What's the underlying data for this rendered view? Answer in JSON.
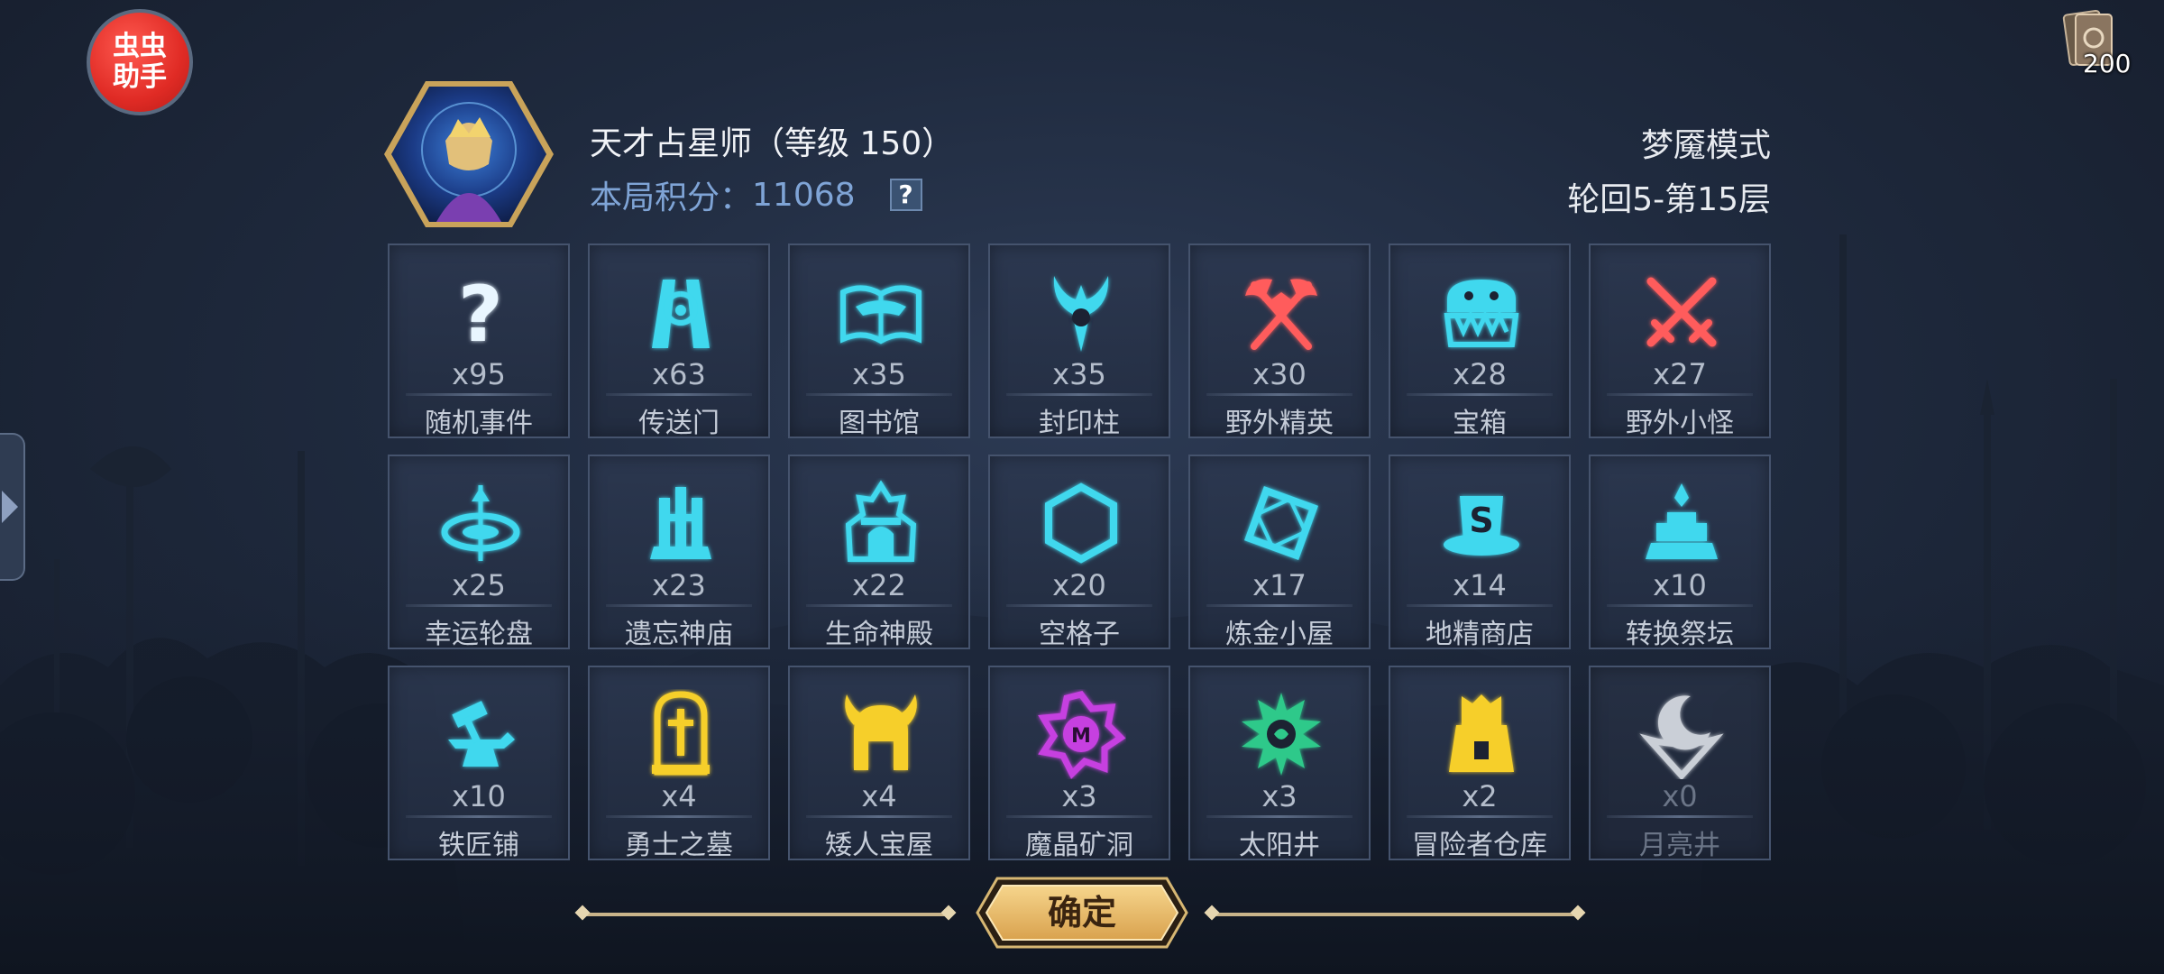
{
  "helper_badge": {
    "line1": "虫虫",
    "line2": "助手"
  },
  "card_counter": {
    "value": "200",
    "icon": "card-deck-icon"
  },
  "player": {
    "name": "天才占星师（等级 150）",
    "score_label": "本局积分：",
    "score_value": "11068",
    "help_label": "?"
  },
  "mode": {
    "name": "梦魇模式",
    "round": "轮回5-第15层"
  },
  "tiles": [
    {
      "label": "随机事件",
      "count": "x95",
      "icon": "question-mark-icon",
      "color": "#e9f6ff"
    },
    {
      "label": "传送门",
      "count": "x63",
      "icon": "portal-icon",
      "color": "#3fd8ee"
    },
    {
      "label": "图书馆",
      "count": "x35",
      "icon": "open-book-icon",
      "color": "#3fd8ee"
    },
    {
      "label": "封印柱",
      "count": "x35",
      "icon": "horned-seal-icon",
      "color": "#3fd8ee"
    },
    {
      "label": "野外精英",
      "count": "x30",
      "icon": "crossed-axes-icon",
      "color": "#ff5c5c"
    },
    {
      "label": "宝箱",
      "count": "x28",
      "icon": "mimic-chest-icon",
      "color": "#3fd8ee"
    },
    {
      "label": "野外小怪",
      "count": "x27",
      "icon": "crossed-swords-icon",
      "color": "#ff5c5c"
    },
    {
      "label": "幸运轮盘",
      "count": "x25",
      "icon": "lucky-wheel-icon",
      "color": "#3fd8ee"
    },
    {
      "label": "遗忘神庙",
      "count": "x23",
      "icon": "temple-icon",
      "color": "#3fd8ee"
    },
    {
      "label": "生命神殿",
      "count": "x22",
      "icon": "life-shrine-icon",
      "color": "#3fd8ee"
    },
    {
      "label": "空格子",
      "count": "x20",
      "icon": "hexagon-icon",
      "color": "#3fd8ee"
    },
    {
      "label": "炼金小屋",
      "count": "x17",
      "icon": "alchemy-frame-icon",
      "color": "#3fd8ee"
    },
    {
      "label": "地精商店",
      "count": "x14",
      "icon": "goblin-shop-icon",
      "color": "#3fd8ee"
    },
    {
      "label": "转换祭坛",
      "count": "x10",
      "icon": "altar-icon",
      "color": "#3fd8ee"
    },
    {
      "label": "铁匠铺",
      "count": "x10",
      "icon": "anvil-hammer-icon",
      "color": "#3fd8ee"
    },
    {
      "label": "勇士之墓",
      "count": "x4",
      "icon": "tombstone-icon",
      "color": "#f6cf2a"
    },
    {
      "label": "矮人宝屋",
      "count": "x4",
      "icon": "horned-helmet-icon",
      "color": "#f6cf2a"
    },
    {
      "label": "魔晶矿洞",
      "count": "x3",
      "icon": "crystal-mine-icon",
      "color": "#c63fe0"
    },
    {
      "label": "太阳井",
      "count": "x3",
      "icon": "sun-well-icon",
      "color": "#2fc98a"
    },
    {
      "label": "冒险者仓库",
      "count": "x2",
      "icon": "warehouse-icon",
      "color": "#f6cf2a"
    },
    {
      "label": "月亮井",
      "count": "x0",
      "icon": "moon-well-icon",
      "color": "#e8ecf2",
      "dim": true
    }
  ],
  "confirm": {
    "label": "确定"
  },
  "colors": {
    "cyan": "#3fd8ee",
    "red": "#ff5c5c",
    "gold": "#f6cf2a",
    "purple": "#c63fe0",
    "green": "#2fc98a",
    "button_gold": "#e9bf6e"
  }
}
